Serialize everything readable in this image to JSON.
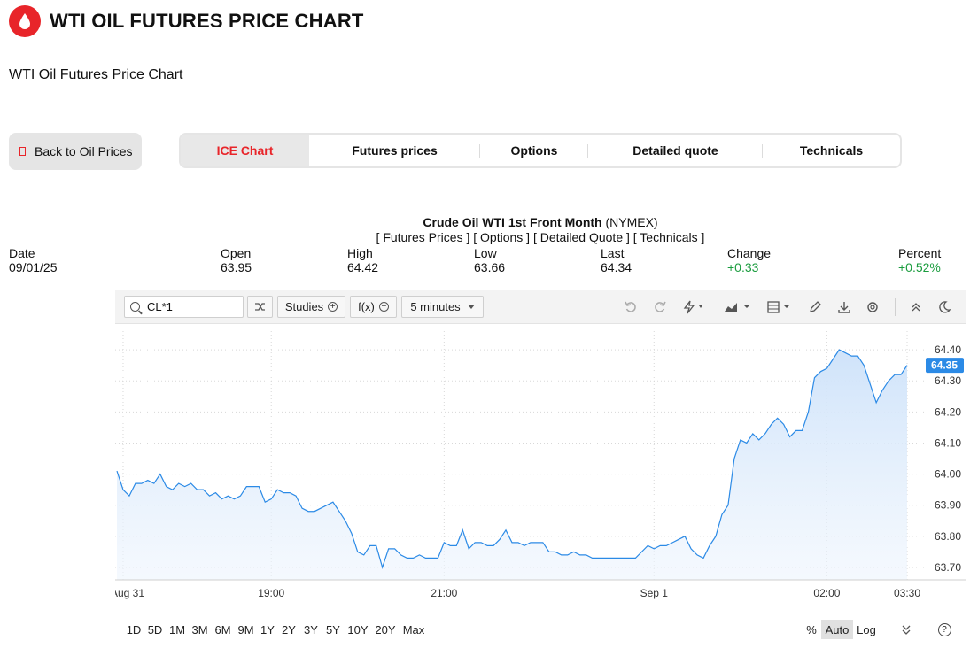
{
  "header": {
    "title": "WTI OIL FUTURES PRICE CHART",
    "logo_icon": "oil-drop-icon"
  },
  "subtitle": "WTI Oil Futures Price Chart",
  "back_button": {
    "label": "Back to Oil Prices"
  },
  "tabs": [
    {
      "label": "ICE Chart",
      "active": true
    },
    {
      "label": "Futures prices",
      "active": false
    },
    {
      "label": "Options",
      "active": false
    },
    {
      "label": "Detailed quote",
      "active": false
    },
    {
      "label": "Technicals",
      "active": false
    }
  ],
  "quote": {
    "name": "Crude Oil WTI 1st Front Month",
    "exchange": "(NYMEX)",
    "links": "[ Futures Prices ] [ Options ] [ Detailed Quote ] [ Technicals ]",
    "date_label": "Date",
    "date": "09/01/25",
    "open_label": "Open",
    "open": "63.95",
    "high_label": "High",
    "high": "64.42",
    "low_label": "Low",
    "low": "63.66",
    "last_label": "Last",
    "last": "64.34",
    "change_label": "Change",
    "change": "+0.33",
    "percent_label": "Percent",
    "percent": "+0.52%"
  },
  "toolbar": {
    "symbol": "CL*1",
    "studies": "Studies",
    "fx": "f(x)",
    "interval": "5 minutes"
  },
  "ranges": [
    "1D",
    "5D",
    "1M",
    "3M",
    "6M",
    "9M",
    "1Y",
    "2Y",
    "3Y",
    "5Y",
    "10Y",
    "20Y",
    "Max"
  ],
  "scale": {
    "percent": "%",
    "auto": "Auto",
    "log": "Log",
    "help": "?"
  },
  "colors": {
    "accent": "#e8252a",
    "line": "#2b8ae6",
    "up": "#1a9c3e",
    "last_badge": "#2b8ae6"
  },
  "chart_data": {
    "type": "area",
    "title": "",
    "xlabel": "",
    "ylabel": "",
    "ylim": [
      63.66,
      64.46
    ],
    "y_ticks": [
      "64.40",
      "64.30",
      "64.20",
      "64.10",
      "64.00",
      "63.90",
      "63.80",
      "63.70"
    ],
    "x_tick_labels": [
      "Aug 31",
      "19:00",
      "21:00",
      "Sep 1",
      "02:00",
      "03:30"
    ],
    "last_value": "64.35",
    "grid": true,
    "series": [
      {
        "values": [
          64.01,
          63.95,
          63.93,
          63.97,
          63.97,
          63.98,
          63.97,
          64.0,
          63.96,
          63.95,
          63.97,
          63.96,
          63.97,
          63.95,
          63.95,
          63.93,
          63.94,
          63.92,
          63.93,
          63.92,
          63.93,
          63.96,
          63.96,
          63.96,
          63.91,
          63.92,
          63.95,
          63.94,
          63.94,
          63.93,
          63.89,
          63.88,
          63.88,
          63.89,
          63.9,
          63.91,
          63.88,
          63.85,
          63.81,
          63.75,
          63.74,
          63.77,
          63.77,
          63.7,
          63.76,
          63.76,
          63.74,
          63.73,
          63.73,
          63.74,
          63.73,
          63.73,
          63.73,
          63.78,
          63.77,
          63.77,
          63.82,
          63.76,
          63.78,
          63.78,
          63.77,
          63.77,
          63.79,
          63.82,
          63.78,
          63.78,
          63.77,
          63.78,
          63.78,
          63.78,
          63.75,
          63.75,
          63.74,
          63.74,
          63.75,
          63.74,
          63.74,
          63.73,
          63.73,
          63.73,
          63.73,
          63.73,
          63.73,
          63.73,
          63.73,
          63.75,
          63.77,
          63.76,
          63.77,
          63.77,
          63.78,
          63.79,
          63.8,
          63.76,
          63.74,
          63.73,
          63.77,
          63.8,
          63.87,
          63.9,
          64.05,
          64.11,
          64.1,
          64.13,
          64.11,
          64.13,
          64.16,
          64.18,
          64.16,
          64.12,
          64.14,
          64.14,
          64.2,
          64.31,
          64.33,
          64.34,
          64.37,
          64.4,
          64.39,
          64.38,
          64.38,
          64.35,
          64.29,
          64.23,
          64.27,
          64.3,
          64.32,
          64.32,
          64.35
        ]
      }
    ]
  }
}
